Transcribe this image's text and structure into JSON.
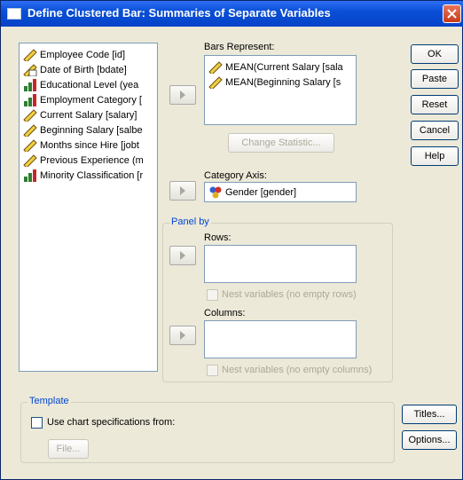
{
  "window": {
    "title": "Define Clustered Bar: Summaries of Separate Variables"
  },
  "variables": [
    {
      "label": "Employee Code [id]",
      "icon": "ruler-icon"
    },
    {
      "label": "Date of Birth [bdate]",
      "icon": "date-ruler-icon"
    },
    {
      "label": "Educational Level (yea",
      "icon": "ordinal-bar-icon"
    },
    {
      "label": "Employment Category [",
      "icon": "ordinal-bar-icon"
    },
    {
      "label": "Current Salary [salary]",
      "icon": "ruler-icon"
    },
    {
      "label": "Beginning Salary [salbe",
      "icon": "ruler-icon"
    },
    {
      "label": "Months since Hire [jobt",
      "icon": "ruler-icon"
    },
    {
      "label": "Previous Experience (m",
      "icon": "ruler-icon"
    },
    {
      "label": "Minority Classification [r",
      "icon": "ordinal-bar-icon"
    }
  ],
  "bars_represent": {
    "label": "Bars Represent:",
    "items": [
      "MEAN(Current Salary [sala",
      "MEAN(Beginning Salary [s"
    ]
  },
  "change_statistic": "Change Statistic...",
  "category_axis": {
    "label": "Category Axis:",
    "value": "Gender [gender]"
  },
  "panel_by": {
    "title": "Panel by",
    "rows_label": "Rows:",
    "nest_rows": "Nest variables (no empty rows)",
    "columns_label": "Columns:",
    "nest_columns": "Nest variables (no empty columns)"
  },
  "template": {
    "title": "Template",
    "use_chart_specs": "Use chart specifications from:",
    "file_button": "File..."
  },
  "buttons": {
    "ok": "OK",
    "paste": "Paste",
    "reset": "Reset",
    "cancel": "Cancel",
    "help": "Help",
    "titles": "Titles...",
    "options": "Options..."
  },
  "colors": {
    "titlebar": "#0a4fd6",
    "group_title": "#0046d5",
    "dialog_bg": "#ece9d8"
  }
}
